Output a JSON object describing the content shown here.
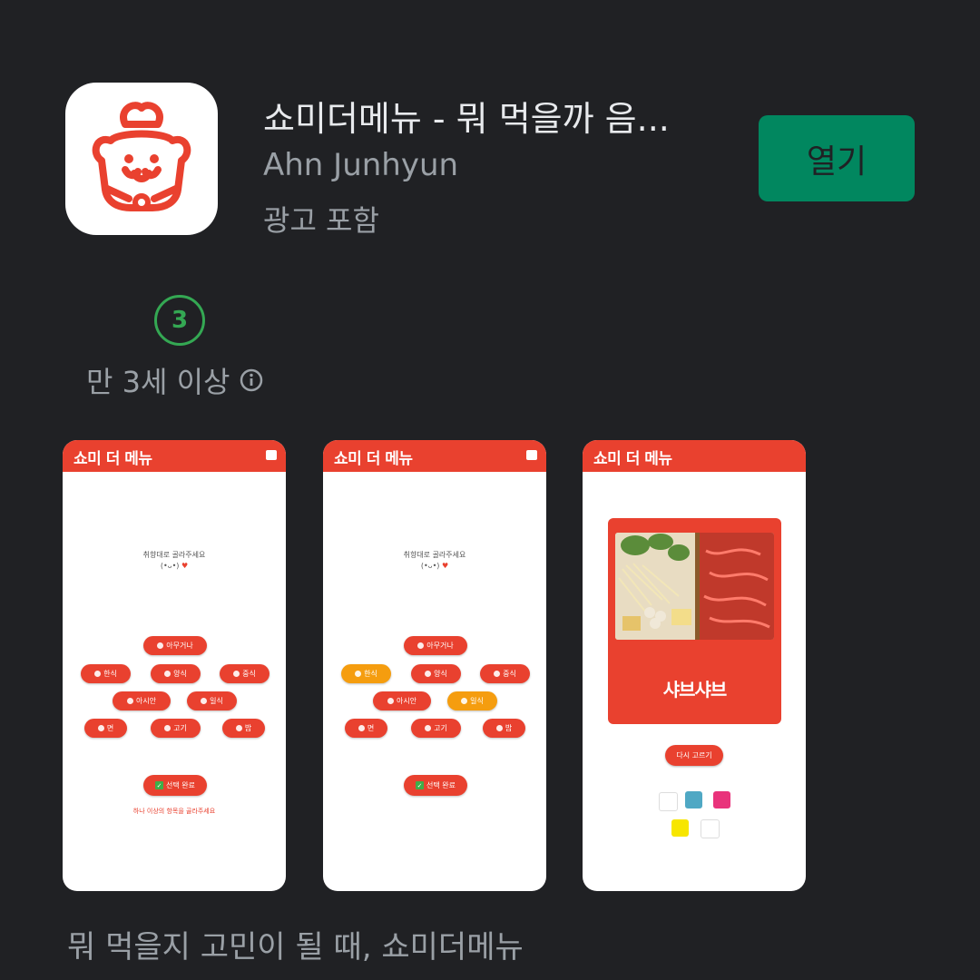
{
  "app": {
    "title": "쇼미더메뉴 - 뭐 먹을까 음...",
    "developer": "Ahn Junhyun",
    "ads_label": "광고 포함",
    "open_label": "열기",
    "icon_name": "chef-bear-icon",
    "accent_color": "#e9412f",
    "button_color": "#01875f"
  },
  "rating": {
    "badge": "3",
    "label": "만 3세 이상",
    "badge_color": "#34a853",
    "info_icon": "info-icon"
  },
  "screenshots": {
    "bar_title": "쇼미 더 메뉴",
    "prompt_line1": "취향대로 골라주세요",
    "prompt_line2": "(•ᴗ•)",
    "menu_items": {
      "any": "아무거나",
      "korean": "한식",
      "western": "양식",
      "chinese": "중식",
      "asian": "아시안",
      "japanese": "일식",
      "noodle": "면",
      "meat": "고기",
      "rice": "밥"
    },
    "done_label": "선택 완료",
    "hint": "하나 이상의 항목을 골라주세요",
    "result_name": "샤브샤브",
    "retry_label": "다시 고르기",
    "selected_color": "#f59d0f"
  },
  "caption": "뭐 먹을지 고민이 될 때, 쇼미더메뉴"
}
